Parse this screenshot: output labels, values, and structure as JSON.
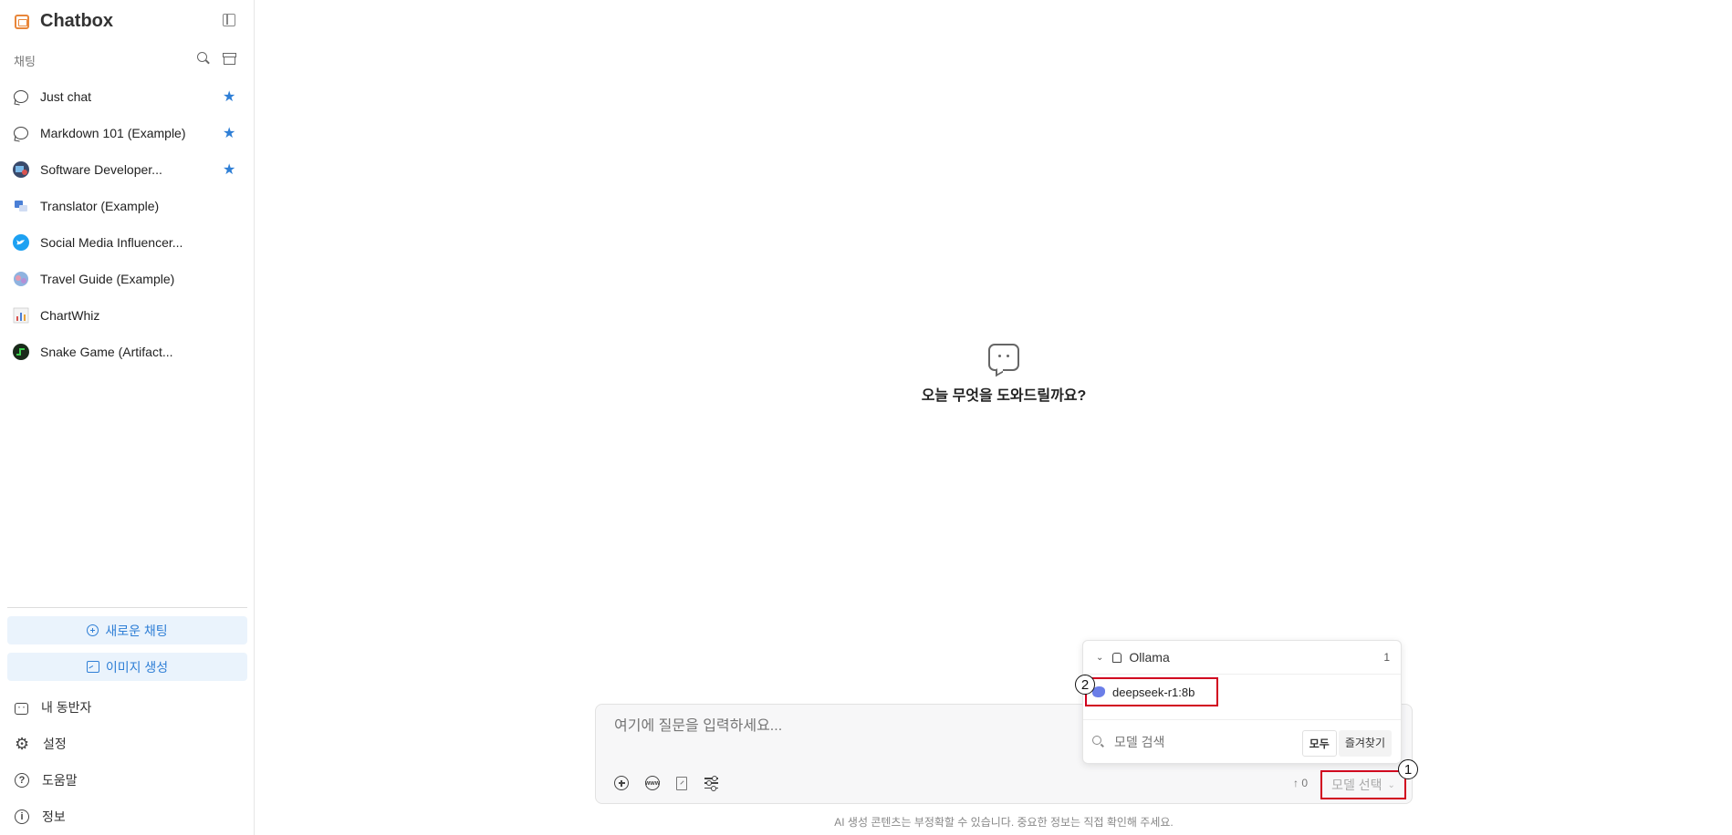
{
  "app": {
    "title": "Chatbox"
  },
  "sidebar": {
    "section_label": "채팅",
    "chats": [
      {
        "label": "Just chat",
        "icon": "chat-bubble-icon",
        "starred": true
      },
      {
        "label": "Markdown 101 (Example)",
        "icon": "chat-bubble-icon",
        "starred": true
      },
      {
        "label": "Software Developer...",
        "icon": "avatar-developer",
        "starred": true
      },
      {
        "label": "Translator (Example)",
        "icon": "avatar-translator",
        "starred": false
      },
      {
        "label": "Social Media Influencer...",
        "icon": "avatar-twitter",
        "starred": false
      },
      {
        "label": "Travel Guide (Example)",
        "icon": "avatar-travel",
        "starred": false
      },
      {
        "label": "ChartWhiz",
        "icon": "avatar-chartwhiz",
        "starred": false
      },
      {
        "label": "Snake Game (Artifact...",
        "icon": "avatar-snake",
        "starred": false
      }
    ],
    "new_chat": "새로운 채팅",
    "image_gen": "이미지 생성",
    "nav": [
      {
        "label": "내 동반자",
        "icon": "companion-icon"
      },
      {
        "label": "설정",
        "icon": "gear-icon"
      },
      {
        "label": "도움말",
        "icon": "help-icon"
      },
      {
        "label": "정보",
        "icon": "info-icon"
      }
    ]
  },
  "main": {
    "welcome": "오늘 무엇을 도와드릴까요?",
    "input_placeholder": "여기에 질문을 입력하세요...",
    "token_count": "↑ 0",
    "model_select": "모델 선택",
    "footnote": "AI 생성 콘텐츠는 부정확할 수 있습니다. 중요한 정보는 직접 확인해 주세요."
  },
  "dropdown": {
    "group": "Ollama",
    "group_count": "1",
    "model": "deepseek-r1:8b",
    "search_placeholder": "모델 검색",
    "tab_all": "모두",
    "tab_fav": "즐겨찾기"
  },
  "markers": {
    "m1": "1",
    "m2": "2"
  },
  "colors": {
    "accent": "#2f7fd6",
    "highlight_box": "#d1001f",
    "brand": "#e8863a"
  }
}
